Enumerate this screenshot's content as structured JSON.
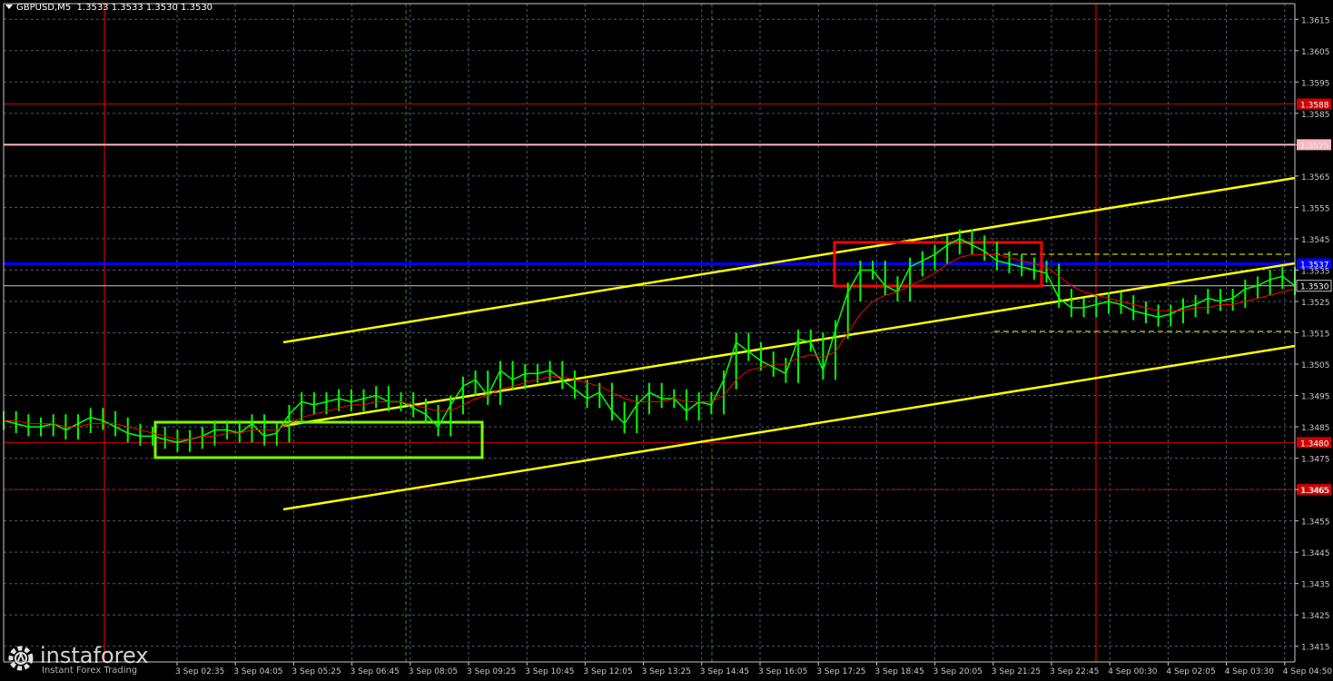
{
  "header": {
    "symbol": "GBPUSD,M5",
    "quote": "1.3533 1.3533 1.3530 1.3530"
  },
  "watermark": {
    "brand": "instaforex",
    "tagline": "Instant Forex Trading"
  },
  "colors": {
    "background": "#000000",
    "grid": "#4a5a6a",
    "axis": "#c8c8c8",
    "candles": "#00ff00",
    "moving_average": "#ff0000",
    "channel": "#ffff00",
    "level_blue": "#0000ff",
    "level_red": "#cc0000",
    "level_pink": "#ffb6c1",
    "box_green": "#7cfc00",
    "box_red": "#ff0000",
    "day_separator": "#ff0000",
    "session_line": "#2e8b2e"
  },
  "chart_data": {
    "type": "line",
    "title": "GBPUSD,M5",
    "ylim": [
      1.341,
      1.362
    ],
    "y_tick_labels": [
      "1.3615",
      "1.3605",
      "1.3595",
      "1.3585",
      "1.3575",
      "1.3565",
      "1.3555",
      "1.3545",
      "1.3535",
      "1.3525",
      "1.3515",
      "1.3505",
      "1.3495",
      "1.3485",
      "1.3475",
      "1.3465",
      "1.3455",
      "1.3445",
      "1.3435",
      "1.3425",
      "1.3415"
    ],
    "x_tick_labels": [
      "3 Sep 02:35",
      "3 Sep 04:05",
      "3 Sep 05:25",
      "3 Sep 06:45",
      "3 Sep 08:05",
      "3 Sep 09:25",
      "3 Sep 10:45",
      "3 Sep 12:05",
      "3 Sep 13:25",
      "3 Sep 14:45",
      "3 Sep 16:05",
      "3 Sep 17:25",
      "3 Sep 18:45",
      "3 Sep 20:05",
      "3 Sep 21:25",
      "3 Sep 22:45",
      "4 Sep 00:30",
      "4 Sep 02:05",
      "4 Sep 03:30",
      "4 Sep 04:50"
    ],
    "grid": true,
    "levels": [
      {
        "name": "level_1.3588",
        "value": 1.3588,
        "label": "1.3588",
        "color": "#cc0000",
        "style": "solid"
      },
      {
        "name": "level_1.3575",
        "value": 1.3575,
        "label": "1.3575",
        "color": "#ffb6c1",
        "style": "solid"
      },
      {
        "name": "level_1.3537",
        "value": 1.3537,
        "label": "1.3537",
        "color": "#0000ff",
        "style": "solid"
      },
      {
        "name": "current_price",
        "value": 1.353,
        "label": "1.3530",
        "color": "#c8c8c8",
        "style": "solid"
      },
      {
        "name": "level_1.3480",
        "value": 1.348,
        "label": "1.3480",
        "color": "#cc0000",
        "style": "solid"
      },
      {
        "name": "level_1.3465",
        "value": 1.3465,
        "label": "1.3465",
        "color": "#cc0000",
        "style": "dashed"
      }
    ],
    "series": [
      {
        "values": [
          1.3487,
          1.3486,
          1.3485,
          1.3485,
          1.3486,
          1.3484,
          1.3486,
          1.3488,
          1.3487,
          1.3485,
          1.3483,
          1.3482,
          1.3482,
          1.3481,
          1.348,
          1.3481,
          1.3482,
          1.3484,
          1.3484,
          1.3483,
          1.3486,
          1.3482,
          1.3483,
          1.3489,
          1.3493,
          1.3492,
          1.3493,
          1.3494,
          1.3493,
          1.3494,
          1.3495,
          1.3493,
          1.3493,
          1.3491,
          1.3489,
          1.3485,
          1.3492,
          1.3498,
          1.35,
          1.3495,
          1.3503,
          1.35,
          1.3502,
          1.3502,
          1.3503,
          1.35,
          1.3497,
          1.3494,
          1.3496,
          1.349,
          1.3486,
          1.3492,
          1.3496,
          1.3494,
          1.3494,
          1.349,
          1.3493,
          1.3492,
          1.35,
          1.3512,
          1.3509,
          1.3506,
          1.3504,
          1.3502,
          1.3513,
          1.3512,
          1.3503,
          1.3516,
          1.3528,
          1.3535,
          1.3535,
          1.353,
          1.3528,
          1.3536,
          1.3538,
          1.354,
          1.3543,
          1.3545,
          1.3543,
          1.3541,
          1.3538,
          1.3537,
          1.3536,
          1.3535,
          1.3534,
          1.3526,
          1.3523,
          1.3523,
          1.3524,
          1.3525,
          1.3524,
          1.3522,
          1.3521,
          1.352,
          1.3521,
          1.3523,
          1.3524,
          1.3526,
          1.3525,
          1.3526,
          1.3529,
          1.353,
          1.3532,
          1.3533,
          1.353
        ]
      },
      {
        "name": "moving average",
        "values": [
          1.3487,
          1.3487,
          1.3486,
          1.3486,
          1.3486,
          1.3485,
          1.3485,
          1.3486,
          1.3486,
          1.3486,
          1.3485,
          1.3484,
          1.3483,
          1.3482,
          1.3481,
          1.3481,
          1.3482,
          1.3482,
          1.3483,
          1.3483,
          1.3484,
          1.3484,
          1.3484,
          1.3486,
          1.3488,
          1.3489,
          1.349,
          1.3491,
          1.3492,
          1.3492,
          1.3493,
          1.3493,
          1.3493,
          1.3492,
          1.3491,
          1.349,
          1.349,
          1.3492,
          1.3494,
          1.3495,
          1.3497,
          1.3498,
          1.3499,
          1.35,
          1.3501,
          1.3501,
          1.35,
          1.3499,
          1.3498,
          1.3496,
          1.3494,
          1.3493,
          1.3493,
          1.3493,
          1.3494,
          1.3493,
          1.3493,
          1.3493,
          1.3495,
          1.35,
          1.3503,
          1.3504,
          1.3505,
          1.3505,
          1.3507,
          1.3508,
          1.3507,
          1.3509,
          1.3515,
          1.3521,
          1.3525,
          1.3527,
          1.3528,
          1.353,
          1.3532,
          1.3534,
          1.3537,
          1.3539,
          1.354,
          1.354,
          1.354,
          1.3539,
          1.3538,
          1.3537,
          1.3536,
          1.3533,
          1.353,
          1.3528,
          1.3527,
          1.3526,
          1.3525,
          1.3524,
          1.3523,
          1.3522,
          1.3522,
          1.3522,
          1.3523,
          1.3523,
          1.3524,
          1.3524,
          1.3525,
          1.3526,
          1.3527,
          1.3528,
          1.3529
        ]
      }
    ]
  }
}
